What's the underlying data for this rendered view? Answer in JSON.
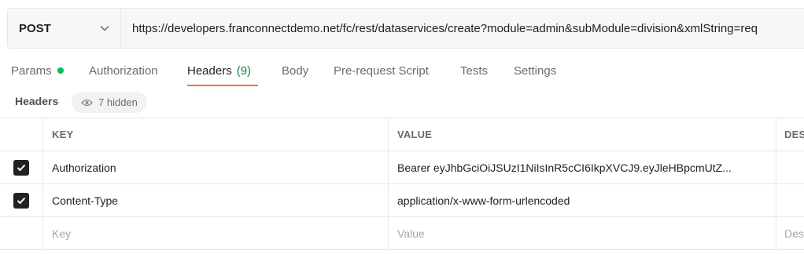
{
  "request": {
    "method": "POST",
    "url": "https://developers.franconnectdemo.net/fc/rest/dataservices/create?module=admin&subModule=division&xmlString=req"
  },
  "tabs": [
    {
      "label": "Params",
      "has_dot": true
    },
    {
      "label": "Authorization"
    },
    {
      "label": "Headers",
      "count": "(9)",
      "active": true
    },
    {
      "label": "Body"
    },
    {
      "label": "Pre-request Script"
    },
    {
      "label": "Tests"
    },
    {
      "label": "Settings"
    }
  ],
  "headers_section": {
    "title": "Headers",
    "hidden_label": "7 hidden"
  },
  "table": {
    "columns": {
      "key": "KEY",
      "value": "VALUE",
      "description": "DES"
    },
    "rows": [
      {
        "checked": true,
        "key": "Authorization",
        "value": "Bearer eyJhbGciOiJSUzI1NiIsInR5cCI6IkpXVCJ9.eyJleHBpcmUtZ..."
      },
      {
        "checked": true,
        "key": "Content-Type",
        "value": "application/x-www-form-urlencoded"
      }
    ],
    "new_row": {
      "key_placeholder": "Key",
      "value_placeholder": "Value",
      "description_placeholder": "Des"
    }
  },
  "colors": {
    "accent": "#ff6c37",
    "dot": "#0cbb52",
    "count": "#0d8a3a"
  }
}
